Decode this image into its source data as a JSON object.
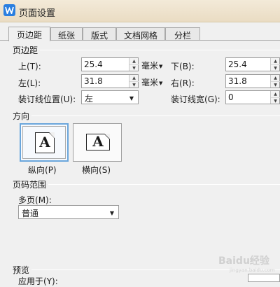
{
  "window": {
    "title": "页面设置",
    "icon": "wps-writer-icon"
  },
  "tabs": [
    {
      "label": "页边距",
      "active": true
    },
    {
      "label": "纸张",
      "active": false
    },
    {
      "label": "版式",
      "active": false
    },
    {
      "label": "文档网格",
      "active": false
    },
    {
      "label": "分栏",
      "active": false
    }
  ],
  "margins": {
    "section": "页边距",
    "top_label": "上",
    "top_key": "(T):",
    "top_value": "25.4",
    "bottom_label": "下",
    "bottom_key": "(B):",
    "bottom_value": "25.4",
    "left_label": "左",
    "left_key": "(L):",
    "left_value": "31.8",
    "right_label": "右",
    "right_key": "(R):",
    "right_value": "31.8",
    "unit": "毫米",
    "gutter_pos_label": "装订线位置",
    "gutter_pos_key": "(U):",
    "gutter_pos_value": "左",
    "gutter_width_label": "装订线宽",
    "gutter_width_key": "(G):",
    "gutter_width_value": "0"
  },
  "orientation": {
    "section": "方向",
    "portrait_label": "纵向",
    "portrait_key": "(P)",
    "landscape_label": "横向",
    "landscape_key": "(S)",
    "glyph": "A",
    "selected": "portrait"
  },
  "pages": {
    "section": "页码范围",
    "multi_label": "多页",
    "multi_key": "(M):",
    "multi_value": "普通"
  },
  "preview": {
    "section": "预览",
    "apply_label": "应用于",
    "apply_key": "(Y):"
  },
  "watermark": {
    "text": "Baidu经验",
    "sub": "jingyan.baidu.com"
  },
  "colors": {
    "accent": "#2a7fe0",
    "selection": "#6aa6dc"
  }
}
